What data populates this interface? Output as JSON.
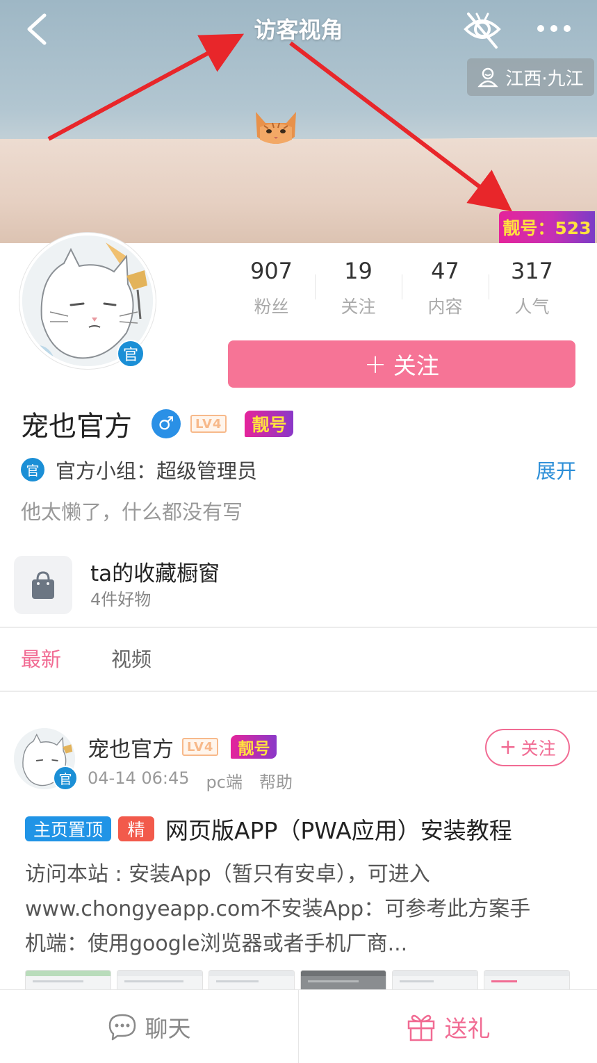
{
  "nav": {
    "title": "访客视角",
    "location": "江西·九江",
    "beauty_number": "靓号：523"
  },
  "profile": {
    "official_badge": "官",
    "stats": [
      {
        "value": "907",
        "label": "粉丝"
      },
      {
        "value": "19",
        "label": "关注"
      },
      {
        "value": "47",
        "label": "内容"
      },
      {
        "value": "317",
        "label": "人气"
      }
    ],
    "follow_label": "关注",
    "follow_plus": "+",
    "name": "宠也官方",
    "gender_symbol": "♂",
    "level": "LV4",
    "beauty_badge": "靓号",
    "group_text": "官方小组：超级管理员",
    "expand_label": "展开",
    "bio": "他太懒了，什么都没有写"
  },
  "showcase": {
    "title": "ta的收藏橱窗",
    "subtitle": "4件好物"
  },
  "tabs": [
    {
      "label": "最新",
      "active": true
    },
    {
      "label": "视频",
      "active": false
    }
  ],
  "post": {
    "author": "宠也官方",
    "level": "LV4",
    "beauty_badge": "靓号",
    "official_badge": "官",
    "follow_label": "关注",
    "follow_plus": "+",
    "time": "04-14 06:45",
    "source": "pc端",
    "category": "帮助",
    "tag_pin": "主页置顶",
    "tag_featured": "精",
    "title": "网页版APP（PWA应用）安装教程",
    "body_lines": [
      "访问本站 : 安装App（暂只有安卓），可进入",
      "www.chongyeapp.com不安装App：可参考此方案手",
      "机端：使用google浏览器或者手机厂商..."
    ]
  },
  "bottom": {
    "chat_label": "聊天",
    "gift_label": "送礼"
  },
  "colors": {
    "accent_pink": "#f67496",
    "link_blue": "#2d8fd8",
    "official_blue": "#1b8fd6",
    "annotation_red": "#e8262a"
  }
}
